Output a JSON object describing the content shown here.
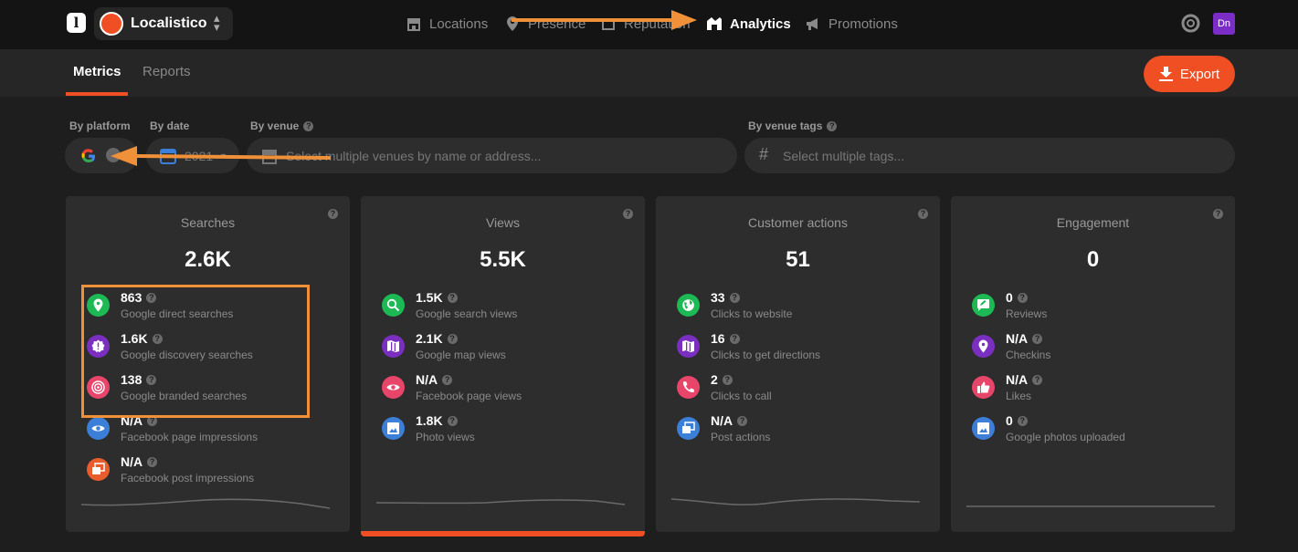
{
  "app": {
    "logo_letter": "l",
    "brand_name": "Localistico",
    "brand_caret": "⌃⌄",
    "avatar_initials": "Dn"
  },
  "nav": [
    {
      "label": "Locations",
      "icon": "store-icon"
    },
    {
      "label": "Presence",
      "icon": "pin-icon"
    },
    {
      "label": "Reputation",
      "icon": "calendar-icon"
    },
    {
      "label": "Analytics",
      "icon": "analytics-icon",
      "active": true
    },
    {
      "label": "Promotions",
      "icon": "megaphone-icon"
    }
  ],
  "tabs": {
    "metrics": "Metrics",
    "reports": "Reports"
  },
  "export_label": "Export",
  "filters": {
    "platform_label": "By platform",
    "date_label": "By date",
    "date_value": "2021",
    "venue_label": "By venue",
    "venue_placeholder": "Select multiple venues by name or address...",
    "tags_label": "By venue tags",
    "tags_placeholder": "Select multiple tags..."
  },
  "cards": [
    {
      "title": "Searches",
      "total": "2.6K",
      "metrics": [
        {
          "value": "863",
          "label": "Google direct searches",
          "icon": "pin-icon",
          "color": "#1db954"
        },
        {
          "value": "1.6K",
          "label": "Google discovery searches",
          "icon": "badge-alert-icon",
          "color": "#7b2fc0"
        },
        {
          "value": "138",
          "label": "Google branded searches",
          "icon": "target-icon",
          "color": "#e8456b"
        },
        {
          "value": "N/A",
          "label": "Facebook page impressions",
          "icon": "eye-icon",
          "color": "#3c7fd8"
        },
        {
          "value": "N/A",
          "label": "Facebook post impressions",
          "icon": "posts-icon",
          "color": "#e85d2e"
        }
      ]
    },
    {
      "title": "Views",
      "total": "5.5K",
      "metrics": [
        {
          "value": "1.5K",
          "label": "Google search views",
          "icon": "search-icon",
          "color": "#1db954"
        },
        {
          "value": "2.1K",
          "label": "Google map views",
          "icon": "map-icon",
          "color": "#7b2fc0"
        },
        {
          "value": "N/A",
          "label": "Facebook page views",
          "icon": "eye-icon",
          "color": "#e8456b"
        },
        {
          "value": "1.8K",
          "label": "Photo views",
          "icon": "image-icon",
          "color": "#3c7fd8"
        }
      ]
    },
    {
      "title": "Customer actions",
      "total": "51",
      "metrics": [
        {
          "value": "33",
          "label": "Clicks to website",
          "icon": "globe-icon",
          "color": "#1db954"
        },
        {
          "value": "16",
          "label": "Clicks to get directions",
          "icon": "map-icon",
          "color": "#7b2fc0"
        },
        {
          "value": "2",
          "label": "Clicks to call",
          "icon": "phone-icon",
          "color": "#e8456b"
        },
        {
          "value": "N/A",
          "label": "Post actions",
          "icon": "posts-icon",
          "color": "#3c7fd8"
        }
      ]
    },
    {
      "title": "Engagement",
      "total": "0",
      "metrics": [
        {
          "value": "0",
          "label": "Reviews",
          "icon": "review-icon",
          "color": "#1db954"
        },
        {
          "value": "N/A",
          "label": "Checkins",
          "icon": "pin-icon",
          "color": "#7b2fc0"
        },
        {
          "value": "N/A",
          "label": "Likes",
          "icon": "thumbs-up-icon",
          "color": "#e8456b"
        },
        {
          "value": "0",
          "label": "Google photos uploaded",
          "icon": "image-icon",
          "color": "#3c7fd8"
        }
      ]
    }
  ],
  "colors": {
    "accent": "#f04e23",
    "annotation": "#f0913a"
  }
}
